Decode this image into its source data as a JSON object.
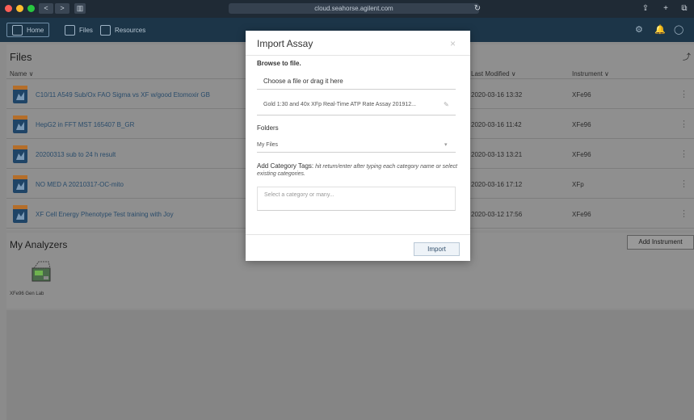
{
  "browser": {
    "url": "cloud.seahorse.agilent.com",
    "nav_back": "<",
    "nav_forward": ">",
    "sidebar_toggle": "▥",
    "right_icons": [
      "share-icon",
      "plus-icon",
      "tabs-icon"
    ]
  },
  "appnav": {
    "items": [
      {
        "label": "Home",
        "icon": "home-icon"
      },
      {
        "label": "Files",
        "icon": "files-icon"
      },
      {
        "label": "Resources",
        "icon": "resources-icon"
      }
    ]
  },
  "files": {
    "title": "Files",
    "corner": "⤴",
    "columns": {
      "name": "Name ∨",
      "modified": "Last Modified ∨",
      "instrument": "Instrument ∨"
    },
    "rows": [
      {
        "name": "C10/11 A549 Sub/Ox FAO Sigma vs XF w/good Etomoxir GB",
        "modified": "2020-03-16 13:32",
        "instrument": "XFe96"
      },
      {
        "name": "HepG2 in FFT MST 165407 B_GR",
        "modified": "2020-03-16 11:42",
        "instrument": "XFe96"
      },
      {
        "name": "20200313 sub to 24 h result",
        "modified": "2020-03-13 13:21",
        "instrument": "XFe96"
      },
      {
        "name": "NO MED A 20210317-OC-mito",
        "modified": "2020-03-16 17:12",
        "instrument": "XFp"
      },
      {
        "name": "XF Cell Energy Phenotype Test training with Joy",
        "modified": "2020-03-12 17:56",
        "instrument": "XFe96"
      }
    ]
  },
  "analyzers": {
    "title": "My Analyzers",
    "add_label": "Add Instrument",
    "machine_label": "XFe96 Gen Lab"
  },
  "modal": {
    "title": "Import Assay",
    "close": "×",
    "browse_label": "Browse to file.",
    "choose_text": "Choose a file or drag it here",
    "selected_file": "Gold 1:30 and 40x XFp Real-Time ATP Rate Assay 201912...",
    "folders_label": "Folders",
    "folder_value": "My Files",
    "category_label": "Add Category Tags:",
    "category_hint_inline": "hit return/enter after typing each category",
    "category_hint_rest": "name or select existing categories.",
    "category_placeholder": "Select a category or many...",
    "import_label": "Import"
  },
  "colors": {
    "nav_bg": "#1c3548",
    "overlay": "#8f8f8f",
    "link": "#2a4c6b"
  }
}
